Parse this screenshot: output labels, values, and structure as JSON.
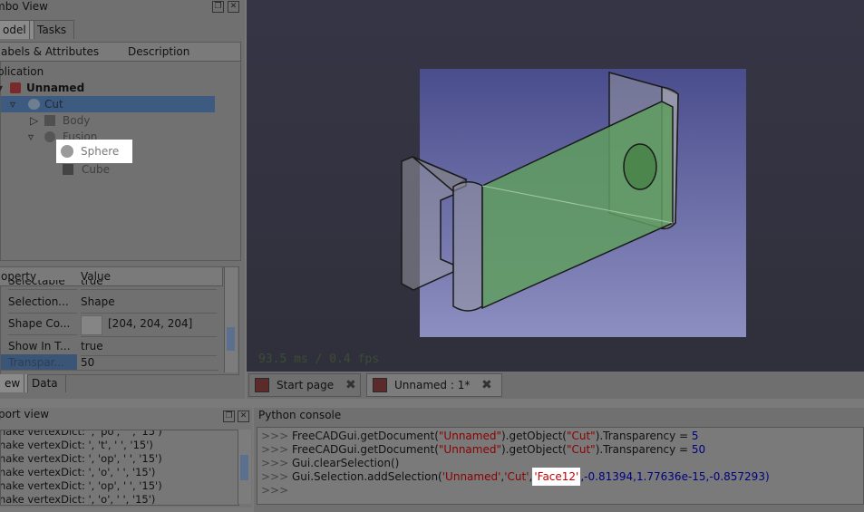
{
  "combo_view": {
    "title": "mbo View",
    "tabs": [
      "odel",
      "Tasks"
    ],
    "tree_headers": [
      "abels & Attributes",
      "Description"
    ],
    "tree": {
      "application": "plication",
      "document": "Unnamed",
      "cut": "Cut",
      "body": "Body",
      "fusion": "Fusion",
      "sphere": "Sphere",
      "cube": "Cube"
    },
    "property_headers": [
      "operty",
      "Value"
    ],
    "properties": [
      {
        "name": "Selectable",
        "value": "true"
      },
      {
        "name": "Selection...",
        "value": "Shape"
      },
      {
        "name": "Shape Co...",
        "value": "[204, 204, 204]"
      },
      {
        "name": "Show In T...",
        "value": "true"
      },
      {
        "name": "Transpar...",
        "value": "50"
      }
    ],
    "bottom_tabs": [
      "ew",
      "Data"
    ]
  },
  "report_view": {
    "title": "port view",
    "lines": [
      "nake vertexDict: ', 'po', ' ', '15')",
      "nake vertexDict: ', 't', ' ', '15')",
      "nake vertexDict: ', 'op', ' ', '15')",
      "nake vertexDict: ', 'o', ' ', '15')",
      "nake vertexDict: ', 'op', ' ', '15')",
      "nake vertexDict: ', 'o', ' ', '15')"
    ]
  },
  "viewer": {
    "fps_text": "93.5 ms / 0.4 fps",
    "colors": {
      "background": "#34343f",
      "face_green": "#5e9a5e",
      "gradient_top": "#4a4d8c",
      "gradient_bottom": "#8d8fc1"
    }
  },
  "doc_tabs": [
    {
      "label": "Start page",
      "icon": "freecad-icon"
    },
    {
      "label": "Unnamed : 1*",
      "icon": "freecad-icon"
    }
  ],
  "python_console": {
    "title": "Python console",
    "prompt": ">>>",
    "lines": [
      {
        "pre": "FreeCADGui.getDocument(",
        "s1": "\"Unnamed\"",
        "mid": ").getObject(",
        "s2": "\"Cut\"",
        "post": ").Transparency = ",
        "num": "5"
      },
      {
        "pre": "FreeCADGui.getDocument(",
        "s1": "\"Unnamed\"",
        "mid": ").getObject(",
        "s2": "\"Cut\"",
        "post": ").Transparency = ",
        "num": "50"
      },
      {
        "text": "Gui.clearSelection()"
      },
      {
        "pre": "Gui.Selection.addSelection(",
        "s1": "'Unnamed'",
        "c1": ",",
        "s2": "'Cut'",
        "c2": ",",
        "s3": "'Face12'",
        "tail": ",-0.81394,1.77636e-15,-0.857293)"
      }
    ]
  }
}
